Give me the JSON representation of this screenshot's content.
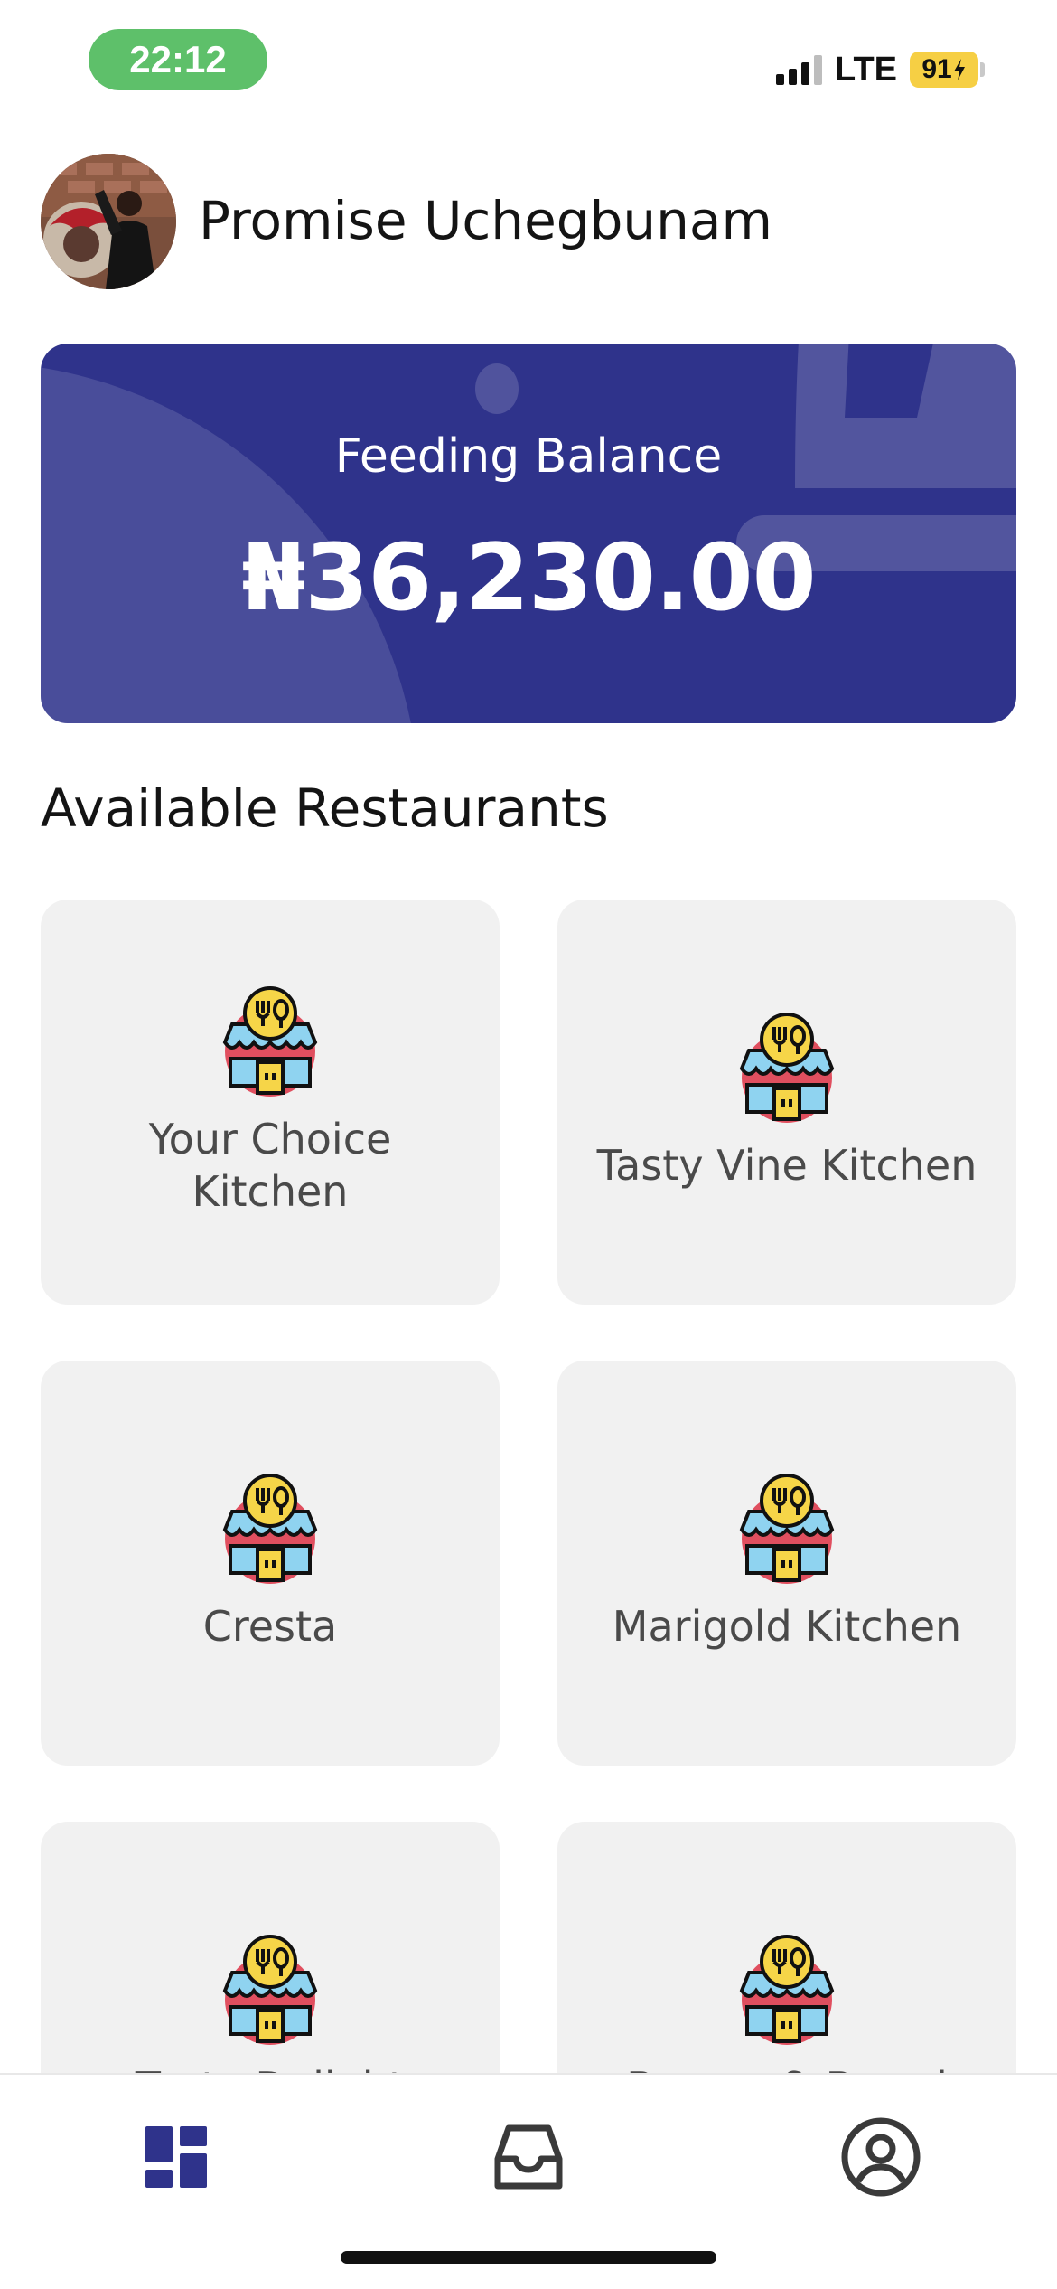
{
  "status_bar": {
    "time": "22:12",
    "network": "LTE",
    "battery": "91",
    "icons": [
      "signal-icon",
      "battery-charging-icon"
    ]
  },
  "profile": {
    "name": "Promise Uchegbunam"
  },
  "balance": {
    "label": "Feeding Balance",
    "amount": "₦36,230.00"
  },
  "restaurants": {
    "title": "Available Restaurants",
    "items": [
      {
        "name": "Your Choice Kitchen"
      },
      {
        "name": "Tasty Vine Kitchen"
      },
      {
        "name": "Cresta"
      },
      {
        "name": "Marigold Kitchen"
      },
      {
        "name": "Tasty Delight"
      },
      {
        "name": "Burger & Bread"
      }
    ]
  },
  "bottom_nav": {
    "items": [
      "dashboard-icon",
      "inbox-icon",
      "profile-icon"
    ],
    "active_color": "#2f338b",
    "inactive_color": "#3a3a3a"
  },
  "colors": {
    "brand": "#2f338b",
    "card_bg": "#f1f1f1",
    "status_pill": "#5ec06a",
    "battery": "#f6cf44"
  }
}
